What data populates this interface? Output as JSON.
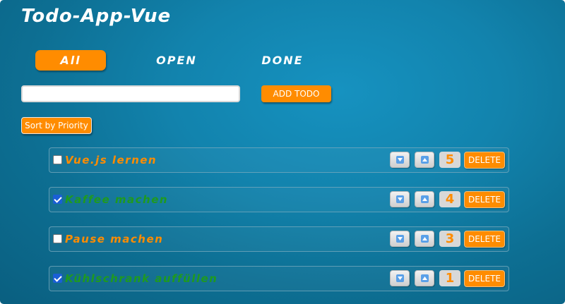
{
  "app": {
    "title": "Todo-App-Vue"
  },
  "filters": [
    {
      "label": "All",
      "active": true
    },
    {
      "label": "OPEN",
      "active": false
    },
    {
      "label": "DONE",
      "active": false
    }
  ],
  "input": {
    "value": "",
    "placeholder": ""
  },
  "add_button": {
    "label": "ADD TODO"
  },
  "sort_button": {
    "label": "Sort by Priority"
  },
  "todos": [
    {
      "text": "Vue.js lernen",
      "done": false,
      "priority": "5",
      "delete_label": "DELETE"
    },
    {
      "text": "Kaffee machen",
      "done": true,
      "priority": "4",
      "delete_label": "DELETE"
    },
    {
      "text": "Pause machen",
      "done": false,
      "priority": "3",
      "delete_label": "DELETE"
    },
    {
      "text": "Kühlschrank auffüllen",
      "done": true,
      "priority": "1",
      "delete_label": "DELETE"
    }
  ],
  "icons": {
    "down": "arrow-down-icon",
    "up": "arrow-up-icon"
  },
  "colors": {
    "accent": "#ff8c00",
    "done_text": "#1f9a1f",
    "background": "#1283ad"
  }
}
